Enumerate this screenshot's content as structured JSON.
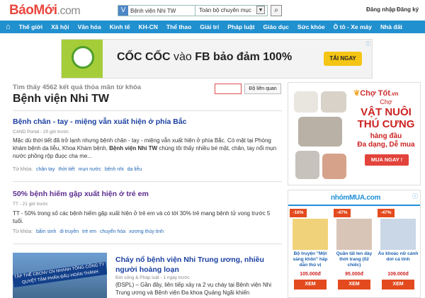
{
  "header": {
    "logo_part1": "Báo",
    "logo_part2": "Mới",
    "logo_part3": ".com",
    "search_value": "Bệnh viện Nhi TW",
    "scope_value": "Toàn bộ chuyên mục",
    "login": "Đăng nhập",
    "register": "Đăng ký"
  },
  "nav": {
    "items": [
      "Thế giới",
      "Xã hội",
      "Văn hóa",
      "Kinh tế",
      "KH-CN",
      "Thể thao",
      "Giải trí",
      "Pháp luật",
      "Giáo dục",
      "Sức khỏe",
      "Ô tô - Xe máy",
      "Nhà đất"
    ]
  },
  "top_ad": {
    "text_bold": "CỐC CỐC",
    "text_normal": " vào ",
    "text_bold2": "FB bảo đảm 100%",
    "cta": "TẢI NGAY"
  },
  "results": {
    "found": "Tìm thấy 4562 kết quả thỏa mãn từ khóa",
    "keyword": "Bệnh viện Nhi TW",
    "sort_button": "Độ liên quan"
  },
  "articles": [
    {
      "title": "Bệnh chân - tay - miệng vẫn xuất hiện ở phía Bắc",
      "meta": "CAND Portal - 20 giờ trước",
      "snippet_a": "Mặc dù thời tiết đã trở lạnh nhưng bệnh chân - tay - miệng vẫn xuất hiện ở phía Bắc. Có mặt tại Phòng khám bệnh da liễu, Khoa Khám bệnh, ",
      "snippet_b": "Bệnh viện Nhi TW",
      "snippet_c": " chúng tôi thấy nhiều bé mặt, chân, tay nổi mụn nước phồng rộp đuọc cha me...",
      "tags_label": "Từ khóa:",
      "tags": [
        "chân tay",
        "thời tiết",
        "mụn nước",
        "bệnh nhi",
        "da liễu"
      ]
    },
    {
      "title": "50% bệnh hiếm gặp xuất hiện ở trẻ em",
      "meta": "TT - 21 giờ trước",
      "snippet": "TT - 50% trong số các bệnh hiếm gặp xuất hiện ở trẻ em và có tới 30% trẻ mang bệnh tử vong trước 5 tuổi.",
      "tags_label": "Từ khóa:",
      "tags": [
        "bẩm sinh",
        "di truyền",
        "trẻ em",
        "chuyển hóa",
        "xương thủy tinh"
      ]
    },
    {
      "title": "Cháy nổ bệnh viện Nhi Trung ương, nhiều người hoảng loạn",
      "meta": "Đời sống & Pháp luật - 1 ngày trước",
      "snippet": "(ĐSPL) – Gần đây, liên tiếp xảy ra 2 vụ cháy tại Bệnh viện Nhi Trung ương và Bệnh viện Đa khoa Quảng Ngãi khiến",
      "image_caption_1": "TẬP THỂ CBCNV CN NHANH TÔNG CÔNG TY",
      "image_caption_2": "QUYẾT TÂM PHẤN ĐẤU HOÀN THÀNH"
    }
  ],
  "ad_chotot": {
    "brand": "Chợ Tốt",
    "brand_suffix": ".vn",
    "line1": "Chợ",
    "line2a": "VẬT NUÔI",
    "line2b": "THÚ CƯNG",
    "line3a": "hàng đầu",
    "line3b": "Đa dạng, Dễ mua",
    "cta": "MUA NGAY !"
  },
  "ad_nhommua": {
    "brand": "nhómMUA.com",
    "products": [
      {
        "discount": "-16%",
        "name": "Bộ truyện \"Một sáng khôn\" hấp dẫn thú vị",
        "price": "105.000đ",
        "cta": "XEM"
      },
      {
        "discount": "-47%",
        "name": "Quần tất len dày thời trang (02 chiếc)",
        "price": "95.000đ",
        "cta": "XEM"
      },
      {
        "discount": "-47%",
        "name": "Áo khoác nữ cánh dơi cá tính",
        "price": "109.000đ",
        "cta": "XEM"
      }
    ]
  },
  "colors": {
    "nav_bg": "#2190cf",
    "logo_red": "#e8473f",
    "link_blue": "#1a3fa0",
    "ad_red": "#e2433b"
  }
}
